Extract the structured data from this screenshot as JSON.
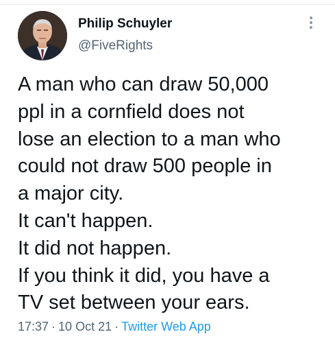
{
  "author": {
    "name": "Philip Schuyler",
    "handle": "@FiveRights"
  },
  "tweet": {
    "lines": [
      "A man who can draw 50,000",
      "ppl in a cornfield does not",
      "lose an election to a man who",
      "could not draw 500 people in",
      "a major city.",
      "It can't happen.",
      "It did not happen.",
      "If you think it did, you have a",
      "TV set between your ears."
    ],
    "time": "17:37",
    "separator": "·",
    "date": "10 Oct 21",
    "source": "Twitter Web App"
  },
  "icons": {
    "more": "more-vertical-icon",
    "avatar": "profile-photo"
  },
  "colors": {
    "text": "#0f1419",
    "muted": "#536471",
    "link": "#1d9bf0"
  }
}
